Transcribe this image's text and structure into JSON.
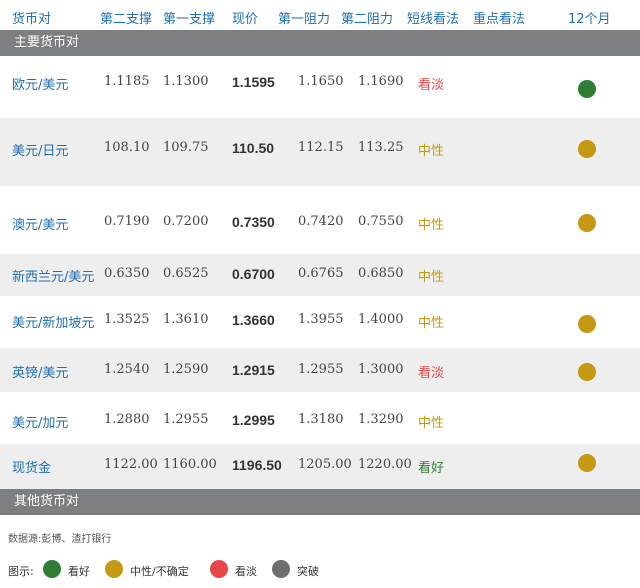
{
  "colors": {
    "bullish": "#2e7d32",
    "neutral": "#c49a14",
    "bearish": "#e8474a",
    "breakout": "#6d6e70",
    "header_text": "#1f6fb2",
    "section_bg": "#7c7f82"
  },
  "header": {
    "pair": "货币对",
    "support2": "第二支撑",
    "support1": "第一支撑",
    "spot": "现价",
    "resist1": "第一阻力",
    "resist2": "第二阻力",
    "short_term": "短线看法",
    "key_view": "重点看法",
    "twelve_month": "12个月"
  },
  "sections": {
    "main": "主要货币对",
    "other": "其他货币对"
  },
  "rows": [
    {
      "pair": "欧元/美元",
      "s2": "1.1185",
      "s1": "1.1300",
      "spot": "1.1595",
      "r1": "1.1650",
      "r2": "1.1690",
      "view": "看淡",
      "view_color": "#e8474a",
      "dot": "#2e7d32"
    },
    {
      "pair": "美元/日元",
      "s2": "108.10",
      "s1": "109.75",
      "spot": "110.50",
      "r1": "112.15",
      "r2": "113.25",
      "view": "中性",
      "view_color": "#c49a14",
      "dot": "#c49a14"
    },
    {
      "pair": "澳元/美元",
      "s2": "0.7190",
      "s1": "0.7200",
      "spot": "0.7350",
      "r1": "0.7420",
      "r2": "0.7550",
      "view": "中性",
      "view_color": "#c49a14",
      "dot": "#c49a14"
    },
    {
      "pair": "新西兰元/美元",
      "s2": "0.6350",
      "s1": "0.6525",
      "spot": "0.6700",
      "r1": "0.6765",
      "r2": "0.6850",
      "view": "中性",
      "view_color": "#c49a14",
      "dot": ""
    },
    {
      "pair": "美元/新加坡元",
      "s2": "1.3525",
      "s1": "1.3610",
      "spot": "1.3660",
      "r1": "1.3955",
      "r2": "1.4000",
      "view": "中性",
      "view_color": "#c49a14",
      "dot": "#c49a14"
    },
    {
      "pair": "英镑/美元",
      "s2": "1.2540",
      "s1": "1.2590",
      "spot": "1.2915",
      "r1": "1.2955",
      "r2": "1.3000",
      "view": "看淡",
      "view_color": "#e8474a",
      "dot": "#c49a14"
    },
    {
      "pair": "美元/加元",
      "s2": "1.2880",
      "s1": "1.2955",
      "spot": "1.2995",
      "r1": "1.3180",
      "r2": "1.3290",
      "view": "中性",
      "view_color": "#c49a14",
      "dot": ""
    },
    {
      "pair": "现货金",
      "s2": "1122.00",
      "s1": "1160.00",
      "spot": "1196.50",
      "r1": "1205.00",
      "r2": "1220.00",
      "view": "看好",
      "view_color": "#2e7d32",
      "dot": "#c49a14"
    }
  ],
  "source": "数据源:彭博、渣打银行",
  "legend": {
    "title": "图示:",
    "bullish": "看好",
    "neutral": "中性/不确定",
    "bearish": "看淡",
    "breakout": "突破"
  }
}
